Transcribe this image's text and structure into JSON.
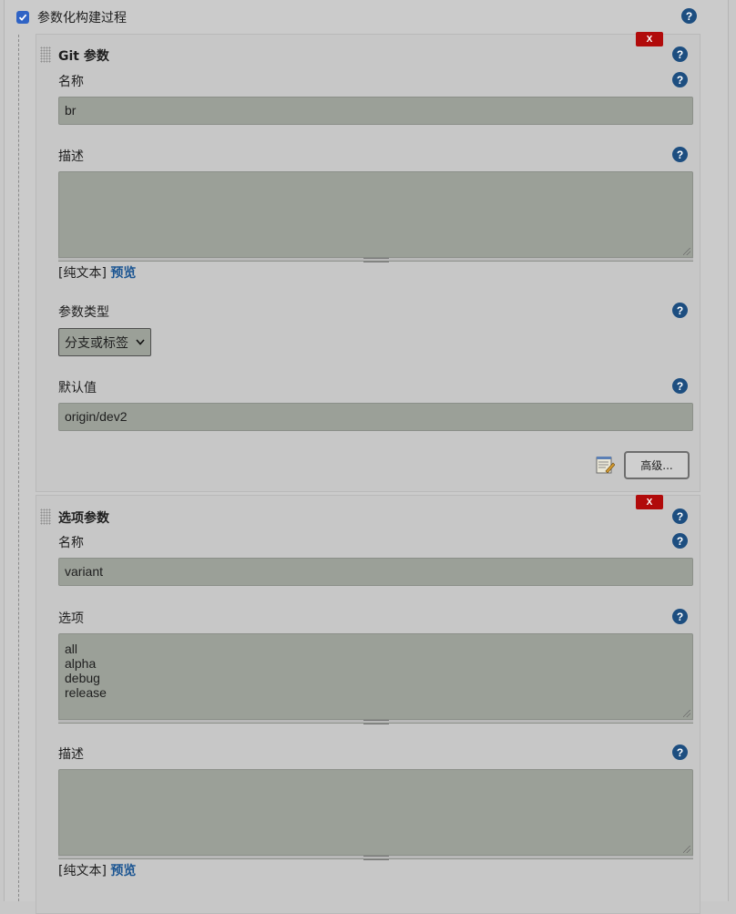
{
  "section": {
    "checkbox_checked": true,
    "title": "参数化构建过程"
  },
  "git_param": {
    "title": "Git 参数",
    "delete_label": "X",
    "name_label": "名称",
    "name_value": "br",
    "desc_label": "描述",
    "desc_value": "",
    "plain_text": "[纯文本]",
    "preview": "预览",
    "type_label": "参数类型",
    "type_value": "分支或标签",
    "default_label": "默认值",
    "default_value": "origin/dev2",
    "advanced_label": "高级..."
  },
  "choice_param": {
    "title": "选项参数",
    "delete_label": "X",
    "name_label": "名称",
    "name_value": "variant",
    "choices_label": "选项",
    "choices_value": "all\nalpha\ndebug\nrelease",
    "desc_label": "描述",
    "desc_value": "",
    "plain_text": "[纯文本]",
    "preview": "预览"
  },
  "icons": {
    "help": "?",
    "checkmark": "✓",
    "select_arrow": "▾"
  },
  "colors": {
    "help_icon": "#1d4e80",
    "delete_button": "#b10b0b",
    "link": "#1b5592",
    "checkbox": "#2f63c5",
    "input_bg": "#9ba098"
  }
}
